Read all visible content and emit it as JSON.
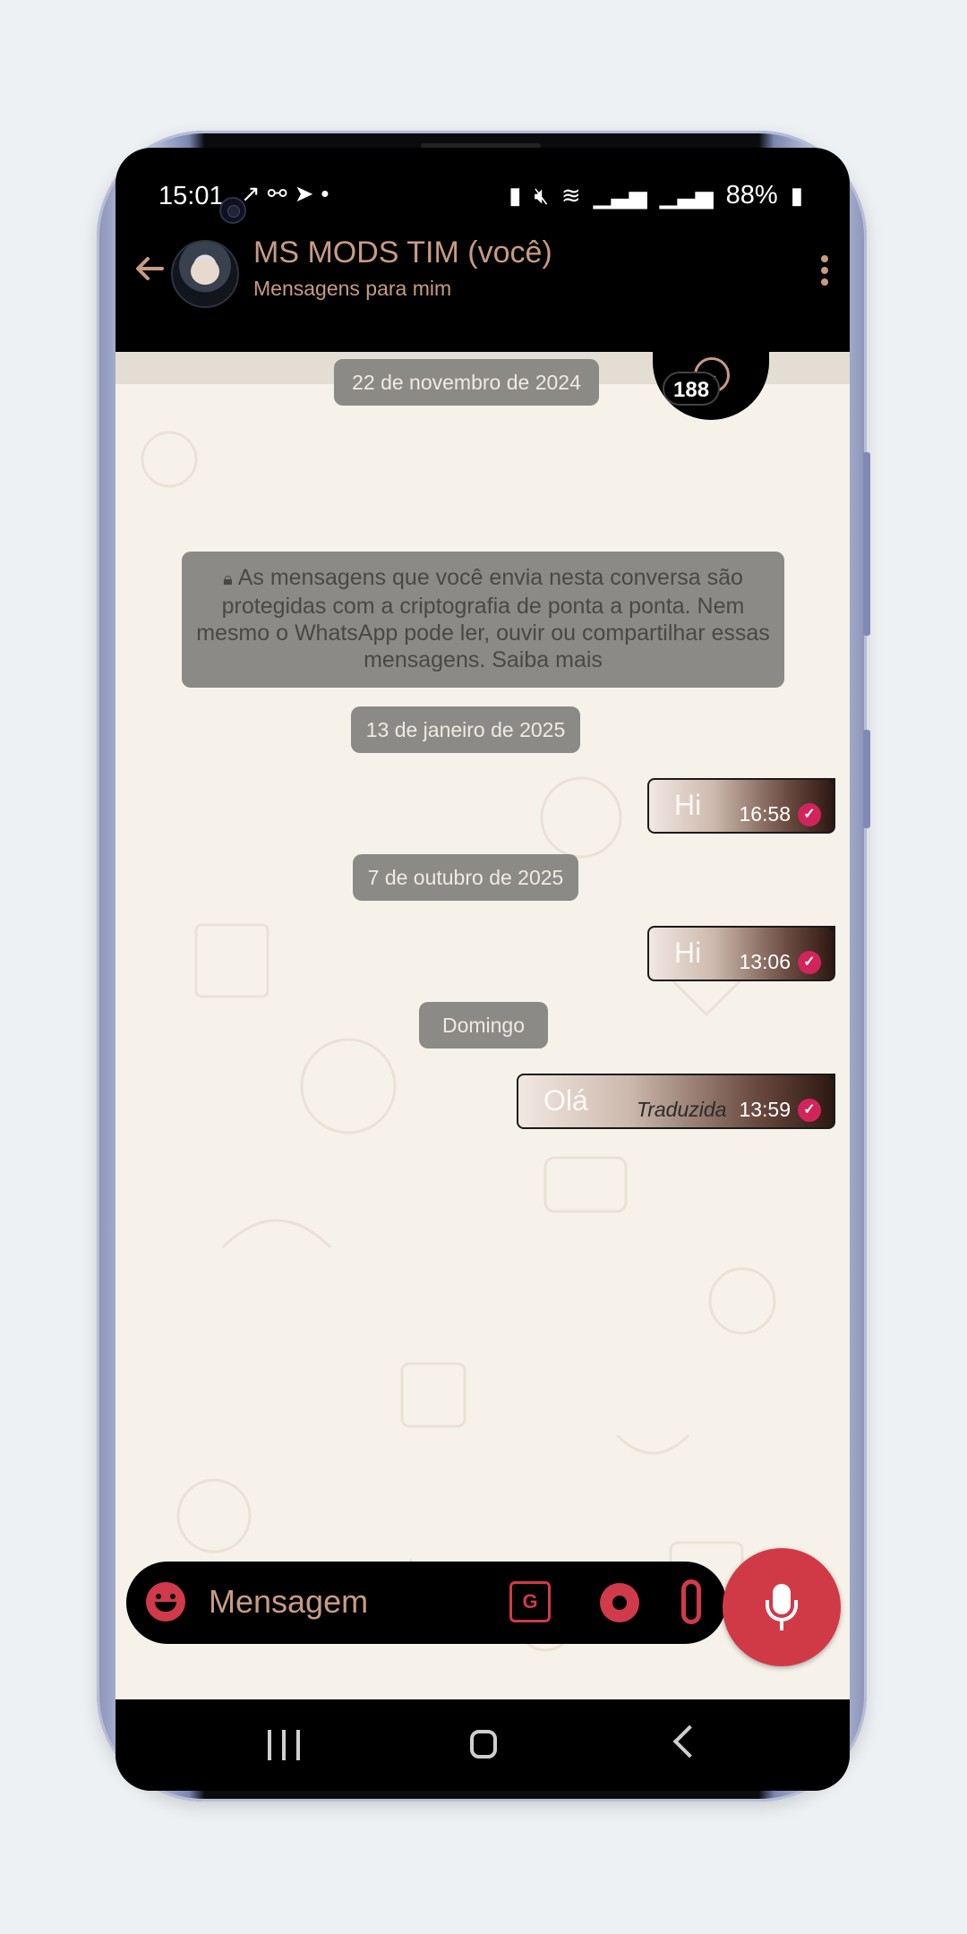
{
  "status_bar": {
    "time": "15:01",
    "battery": "88%",
    "left_icons": [
      "call-icon",
      "link-icon",
      "telegram-icon",
      "dot-icon"
    ],
    "right_icons": [
      "battery-saver-icon",
      "mute-icon",
      "wifi-icon",
      "signal-icon",
      "signal-icon",
      "battery-icon"
    ]
  },
  "header": {
    "title": "MS MODS TIM (você)",
    "subtitle": "Mensagens para mim"
  },
  "unread_count": "188",
  "messages": {
    "date_1": "22 de novembro de 2024",
    "encryption_notice": "As mensagens que você envia nesta conversa são protegidas com a criptografia de ponta a ponta. Nem mesmo o WhatsApp pode ler, ouvir ou compartilhar essas mensagens. Saiba mais",
    "date_2": "13 de janeiro de 2025",
    "msg_1": {
      "text": "Hi",
      "time": "16:58"
    },
    "date_3": "7 de outubro de 2025",
    "msg_2": {
      "text": "Hi",
      "time": "13:06"
    },
    "date_4": "Domingo",
    "msg_3": {
      "text": "Olá",
      "label": "Traduzida",
      "time": "13:59"
    }
  },
  "input": {
    "placeholder": "Mensagem"
  },
  "colors": {
    "accent": "#c89b83",
    "action_red": "#d13a4a",
    "read_check": "#d1245a",
    "chat_bg": "#f6f2ea",
    "date_pill": "#8c8a86"
  }
}
